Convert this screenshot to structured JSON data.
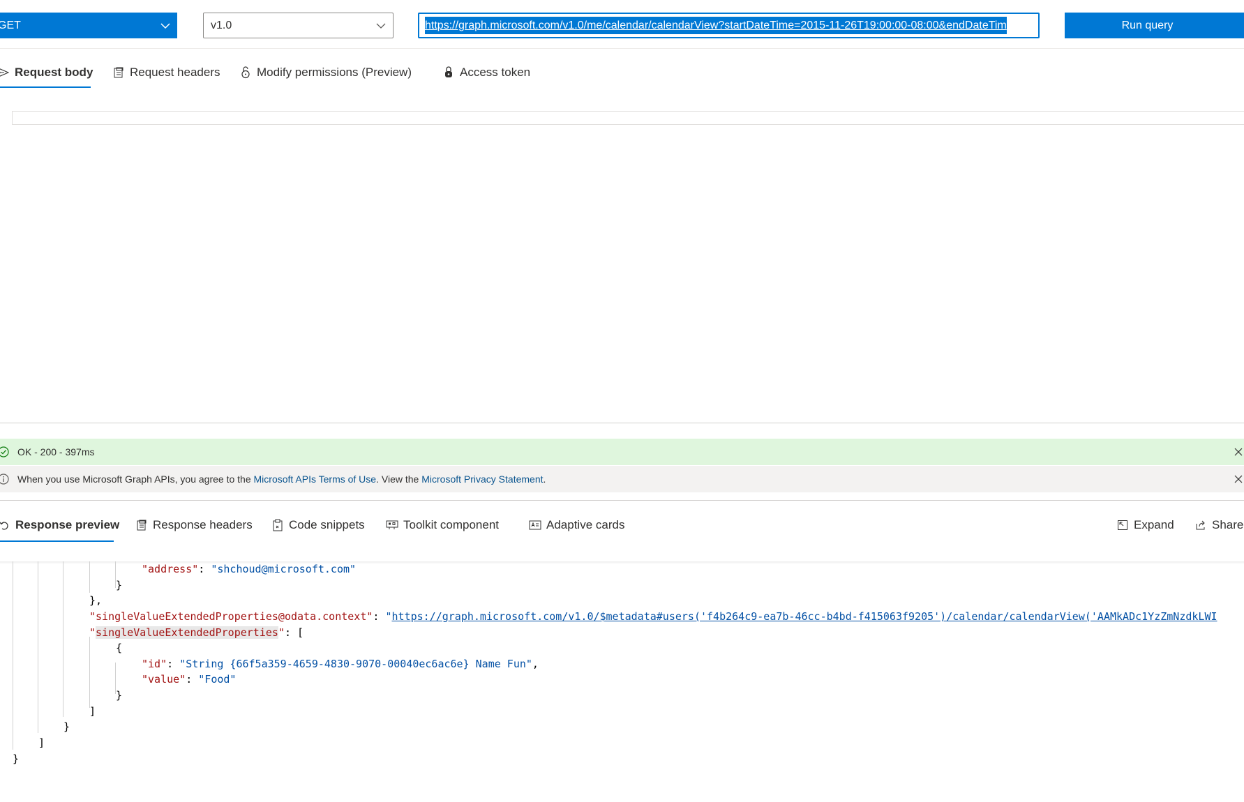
{
  "query_bar": {
    "method": "GET",
    "version": "v1.0",
    "url": "https://graph.microsoft.com/v1.0/me/calendar/calendarView?startDateTime=2015-11-26T19:00:00-08:00&endDateTim",
    "run_label": "Run query"
  },
  "request_tabs": [
    {
      "label": "Request body",
      "icon": "send-icon",
      "active": true
    },
    {
      "label": "Request headers",
      "icon": "document-icon",
      "active": false
    },
    {
      "label": "Modify permissions (Preview)",
      "icon": "lock-icon",
      "active": false
    },
    {
      "label": "Access token",
      "icon": "shield-lock-icon",
      "active": false
    }
  ],
  "status_bar": {
    "text": "OK - 200 - 397ms",
    "color": "#dff6dd"
  },
  "info_bar": {
    "prefix": "When you use Microsoft Graph APIs, you agree to the ",
    "terms_link": "Microsoft APIs Terms of Use",
    "middle": ". View the ",
    "privacy_link": "Microsoft Privacy Statement",
    "suffix": "."
  },
  "response_tabs": [
    {
      "label": "Response preview",
      "icon": "undo-arrow-icon",
      "active": true
    },
    {
      "label": "Response headers",
      "icon": "document-icon",
      "active": false
    },
    {
      "label": "Code snippets",
      "icon": "clipboard-icon",
      "active": false
    },
    {
      "label": "Toolkit component",
      "icon": "toolkit-icon",
      "active": false
    },
    {
      "label": "Adaptive cards",
      "icon": "card-icon",
      "active": false
    }
  ],
  "response_actions": {
    "expand_label": "Expand",
    "share_label": "Share"
  },
  "json_lines": {
    "address_key": "\"address\"",
    "address_value": "\"shchoud@microsoft.com\"",
    "svep_context_key": "\"singleValueExtendedProperties@odata.context\"",
    "svep_context_value": "https://graph.microsoft.com/v1.0/$metadata#users('f4b264c9-ea7b-46cc-b4bd-f415063f9205')/calendar/calendarView('AAMkADc1YzZmNzdkLWI",
    "svep_key": "singleValueExtendedProperties",
    "id_key": "\"id\"",
    "id_value": "\"String {66f5a359-4659-4830-9070-00040ec6ac6e} Name Fun\"",
    "value_key": "\"value\"",
    "value_value": "\"Food\""
  },
  "colors": {
    "accent": "#0078d4",
    "json_key": "#a31515",
    "json_string": "#0451a5"
  }
}
